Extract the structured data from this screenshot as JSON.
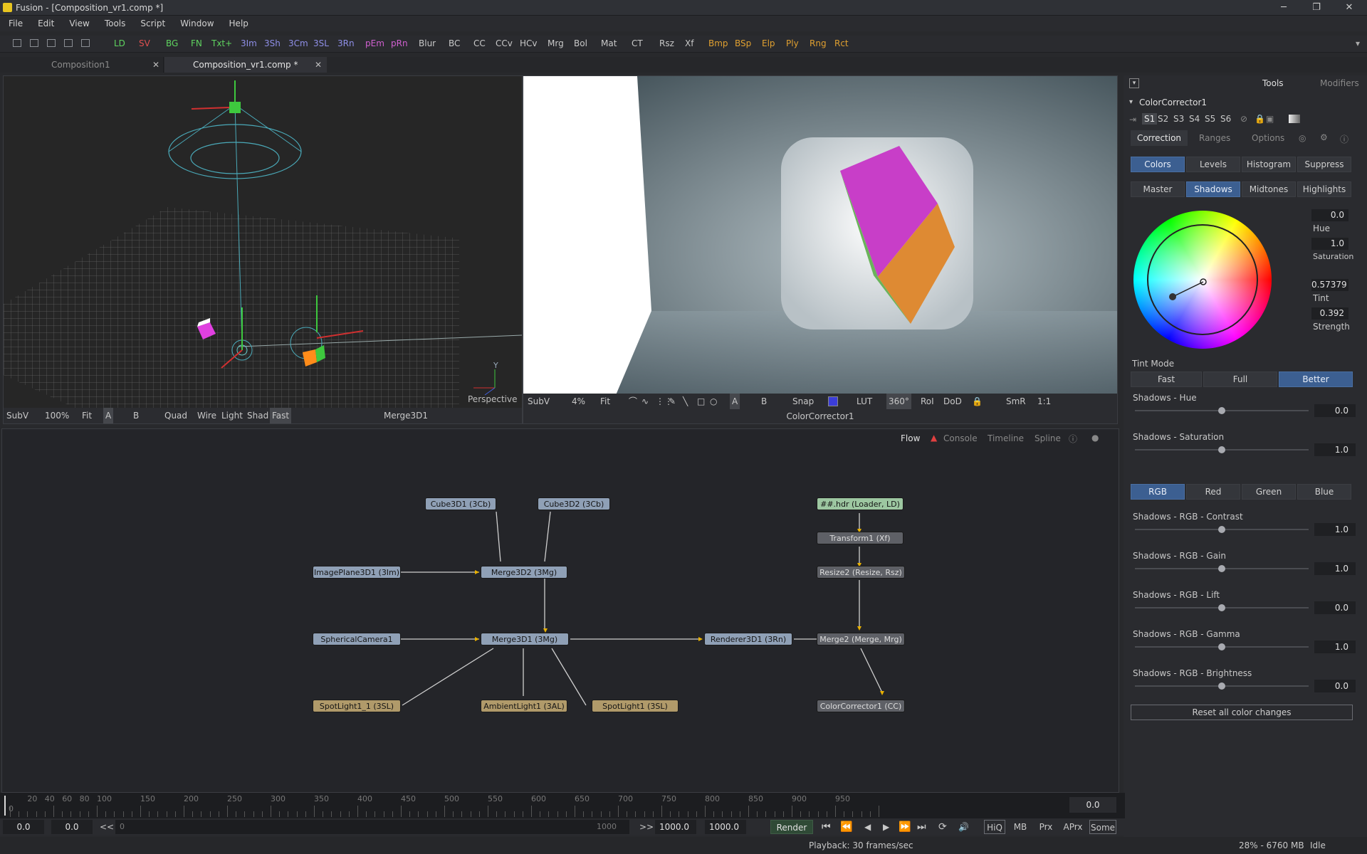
{
  "window": {
    "title": "Fusion - [Composition_vr1.comp *]",
    "min": "─",
    "max": "❐",
    "close": "✕"
  },
  "menu": [
    "File",
    "Edit",
    "View",
    "Tools",
    "Script",
    "Window",
    "Help"
  ],
  "toolbar": [
    {
      "label": "LD",
      "color": "#5fd35f"
    },
    {
      "label": "SV",
      "color": "#e05050"
    },
    {
      "label": "BG",
      "color": "#5fd35f"
    },
    {
      "label": "FN",
      "color": "#5fd35f"
    },
    {
      "label": "Txt+",
      "color": "#5fd35f"
    },
    {
      "label": "3Im",
      "color": "#8f8fe8"
    },
    {
      "label": "3Sh",
      "color": "#8f8fe8"
    },
    {
      "label": "3Cm",
      "color": "#8f8fe8"
    },
    {
      "label": "3SL",
      "color": "#8f8fe8"
    },
    {
      "label": "3Rn",
      "color": "#8f8fe8"
    },
    {
      "label": "pEm",
      "color": "#d060d0"
    },
    {
      "label": "pRn",
      "color": "#d060d0"
    },
    {
      "label": "Blur",
      "color": "#c8c8c8"
    },
    {
      "label": "BC",
      "color": "#c8c8c8"
    },
    {
      "label": "CC",
      "color": "#c8c8c8"
    },
    {
      "label": "CCv",
      "color": "#c8c8c8"
    },
    {
      "label": "HCv",
      "color": "#c8c8c8"
    },
    {
      "label": "Mrg",
      "color": "#c8c8c8"
    },
    {
      "label": "Bol",
      "color": "#c8c8c8"
    },
    {
      "label": "Mat",
      "color": "#c8c8c8"
    },
    {
      "label": "CT",
      "color": "#c8c8c8"
    },
    {
      "label": "Rsz",
      "color": "#c8c8c8"
    },
    {
      "label": "Xf",
      "color": "#c8c8c8"
    },
    {
      "label": "Bmp",
      "color": "#e0a030"
    },
    {
      "label": "BSp",
      "color": "#e0a030"
    },
    {
      "label": "Elp",
      "color": "#e0a030"
    },
    {
      "label": "Ply",
      "color": "#e0a030"
    },
    {
      "label": "Rng",
      "color": "#e0a030"
    },
    {
      "label": "Rct",
      "color": "#e0a030"
    }
  ],
  "tabs": [
    {
      "label": "Composition1"
    },
    {
      "label": "Composition_vr1.comp *"
    }
  ],
  "viewer_left": {
    "label": "Perspective",
    "axis_y": "Y",
    "bar": [
      "SubV",
      "100%",
      "Fit",
      "A",
      "B",
      "Quad",
      "Wire",
      "Light",
      "Shad",
      "Fast"
    ],
    "title": "Merge3D1"
  },
  "viewer_right": {
    "bar": [
      "SubV",
      "4%",
      "Fit",
      "A",
      "B",
      "Snap",
      "LUT",
      "360°",
      "RoI",
      "DoD",
      "SmR",
      "1:1"
    ],
    "title": "ColorCorrector1"
  },
  "inspector": {
    "top_tabs": [
      "Tools",
      "Modifiers"
    ],
    "tool_name": "ColorCorrector1",
    "slots": [
      "S1",
      "S2",
      "S3",
      "S4",
      "S5",
      "S6"
    ],
    "sub_tabs": [
      "Correction",
      "Ranges",
      "Options"
    ],
    "mode_buttons": [
      "Colors",
      "Levels",
      "Histogram",
      "Suppress"
    ],
    "range_buttons": [
      "Master",
      "Shadows",
      "Midtones",
      "Highlights"
    ],
    "wheel": {
      "hue": "0.0",
      "hue_label": "Hue",
      "saturation": "1.0",
      "saturation_label": "Saturation",
      "tint": "0.57379",
      "tint_label": "Tint",
      "strength": "0.392",
      "strength_label": "Strength"
    },
    "tint_mode_label": "Tint Mode",
    "tint_modes": [
      "Fast",
      "Full",
      "Better"
    ],
    "sliders_top": [
      {
        "label": "Shadows - Hue",
        "value": "0.0",
        "level": 0.5
      },
      {
        "label": "Shadows - Saturation",
        "value": "1.0",
        "level": 0.5
      }
    ],
    "channels": [
      "RGB",
      "Red",
      "Green",
      "Blue"
    ],
    "sliders_rgb": [
      {
        "label": "Shadows - RGB - Contrast",
        "value": "1.0",
        "level": 0.5
      },
      {
        "label": "Shadows - RGB - Gain",
        "value": "1.0",
        "level": 0.5
      },
      {
        "label": "Shadows - RGB - Lift",
        "value": "0.0",
        "level": 0.5
      },
      {
        "label": "Shadows - RGB - Gamma",
        "value": "1.0",
        "level": 0.5
      },
      {
        "label": "Shadows - RGB - Brightness",
        "value": "0.0",
        "level": 0.5
      }
    ],
    "reset_label": "Reset all color changes"
  },
  "flow": {
    "tabs": [
      "Flow",
      "Console",
      "Timeline",
      "Spline"
    ],
    "nodes": {
      "cube1": "Cube3D1  (3Cb)",
      "cube2": "Cube3D2  (3Cb)",
      "loader": "##.hdr  (Loader, LD)",
      "transform": "Transform1  (Xf)",
      "resize": "Resize2  (Resize, Rsz)",
      "imageplane": "ImagePlane3D1  (3Im)",
      "merge3d2": "Merge3D2  (3Mg)",
      "camera": "SphericalCamera1",
      "merge3d1": "Merge3D1  (3Mg)",
      "renderer": "Renderer3D1  (3Rn)",
      "merge2": "Merge2  (Merge, Mrg)",
      "spot1_1": "SpotLight1_1  (3SL)",
      "ambient": "AmbientLight1  (3AL)",
      "spot1": "SpotLight1  (3SL)",
      "cc": "ColorCorrector1  (CC)"
    }
  },
  "timeline": {
    "ticks": [
      "0",
      "20",
      "40",
      "60",
      "80",
      "100",
      "150",
      "200",
      "250",
      "300",
      "350",
      "400",
      "450",
      "500",
      "550",
      "600",
      "650",
      "700",
      "750",
      "800",
      "850",
      "900",
      "950"
    ],
    "current": "0.0"
  },
  "transport": {
    "start": "0.0",
    "render_start": "0.0",
    "prev": "<<",
    "range_start": "0",
    "range_end": "1000",
    "next": ">>",
    "render_end": "1000.0",
    "end": "1000.0",
    "render": "Render",
    "toggles": [
      "HiQ",
      "MB",
      "Prx",
      "APrx",
      "Some"
    ]
  },
  "status": {
    "playback": "Playback: 30 frames/sec",
    "memory": "28% - 6760 MB",
    "state": "Idle"
  }
}
